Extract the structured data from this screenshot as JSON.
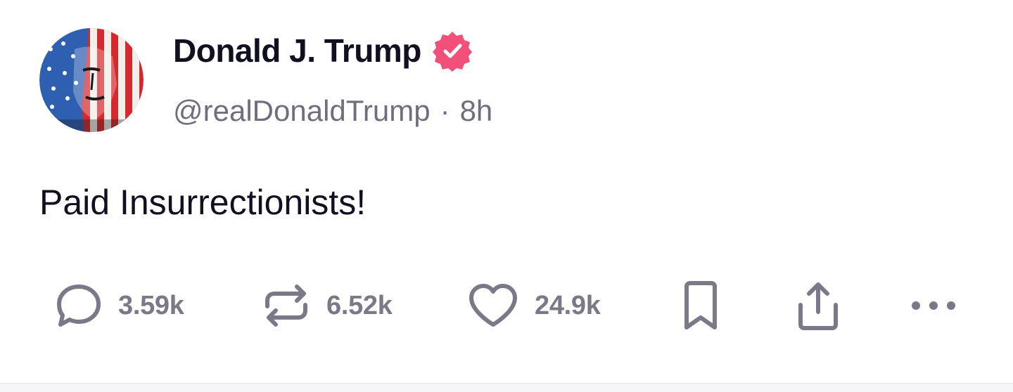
{
  "author": {
    "display_name": "Donald J. Trump",
    "handle": "@realDonaldTrump",
    "separator": "·",
    "time_ago": "8h",
    "verified": true,
    "avatar_icon": "flag-portrait-avatar"
  },
  "post": {
    "text": "Paid Insurrectionists!"
  },
  "actions": {
    "replies": "3.59k",
    "reposts": "6.52k",
    "likes": "24.9k",
    "bookmark_icon": "bookmark-icon",
    "share_icon": "share-icon",
    "more_icon": "more-icon"
  },
  "colors": {
    "verified_badge": "#f0507a",
    "icon_gray": "#7a7987",
    "handle_gray": "#6f6e7c",
    "text": "#101020"
  }
}
